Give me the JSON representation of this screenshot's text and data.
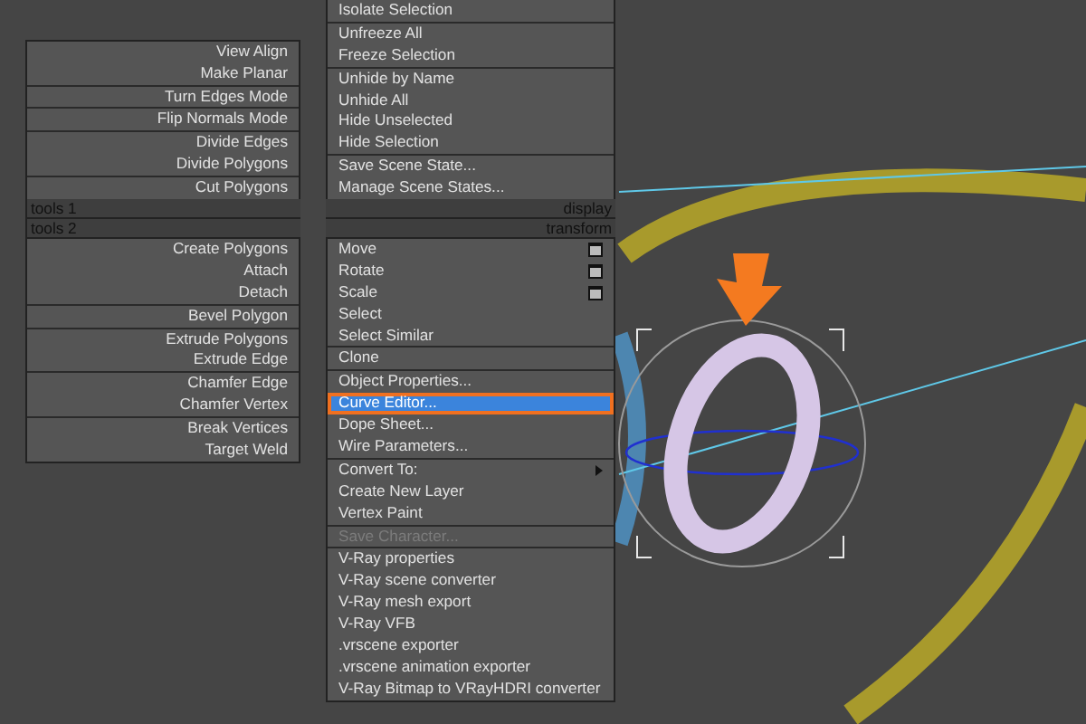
{
  "left_top_groups": [
    [
      {
        "label": "View Align",
        "selected": false,
        "disabled": false
      },
      {
        "label": "Make Planar",
        "selected": false,
        "disabled": false
      }
    ],
    [
      {
        "label": "Turn Edges Mode",
        "selected": false,
        "disabled": false
      }
    ],
    [
      {
        "label": "Flip Normals Mode",
        "selected": false,
        "disabled": false
      }
    ],
    [
      {
        "label": "Divide Edges",
        "selected": false,
        "disabled": false
      },
      {
        "label": "Divide Polygons",
        "selected": false,
        "disabled": false
      }
    ],
    [
      {
        "label": "Cut Polygons",
        "selected": false,
        "disabled": false
      }
    ]
  ],
  "right_top_groups": [
    [
      {
        "label": "Isolate Selection",
        "selected": false,
        "disabled": false
      }
    ],
    [
      {
        "label": "Unfreeze All",
        "selected": false,
        "disabled": false
      },
      {
        "label": "Freeze Selection",
        "selected": false,
        "disabled": false
      }
    ],
    [
      {
        "label": "Unhide by Name",
        "selected": false,
        "disabled": false
      },
      {
        "label": "Unhide All",
        "selected": false,
        "disabled": false
      },
      {
        "label": "Hide Unselected",
        "selected": false,
        "disabled": false
      },
      {
        "label": "Hide Selection",
        "selected": false,
        "disabled": false
      }
    ],
    [
      {
        "label": "Save Scene State...",
        "selected": false,
        "disabled": false
      },
      {
        "label": "Manage Scene States...",
        "selected": false,
        "disabled": false
      }
    ]
  ],
  "headers": [
    {
      "left": "tools 1",
      "right": "display"
    },
    {
      "left": "tools 2",
      "right": "transform"
    }
  ],
  "left_bottom_groups": [
    [
      {
        "label": "Create Polygons",
        "selected": false,
        "disabled": false
      },
      {
        "label": "Attach",
        "selected": false,
        "disabled": false
      },
      {
        "label": "Detach",
        "selected": false,
        "disabled": false
      }
    ],
    [
      {
        "label": "Bevel Polygon",
        "selected": false,
        "disabled": false
      }
    ],
    [
      {
        "label": "Extrude Polygons",
        "selected": false,
        "disabled": false
      },
      {
        "label": "Extrude Edge",
        "selected": false,
        "disabled": false
      }
    ],
    [
      {
        "label": "Chamfer Edge",
        "selected": false,
        "disabled": false
      },
      {
        "label": "Chamfer Vertex",
        "selected": false,
        "disabled": false
      }
    ],
    [
      {
        "label": "Break Vertices",
        "selected": false,
        "disabled": false
      },
      {
        "label": "Target Weld",
        "selected": false,
        "disabled": false
      }
    ]
  ],
  "right_bottom_groups": [
    [
      {
        "label": "Move",
        "selected": false,
        "disabled": false,
        "has_options": true
      },
      {
        "label": "Rotate",
        "selected": false,
        "disabled": false,
        "has_options": true
      },
      {
        "label": "Scale",
        "selected": false,
        "disabled": false,
        "has_options": true
      },
      {
        "label": "Select",
        "selected": false,
        "disabled": false
      },
      {
        "label": "Select Similar",
        "selected": false,
        "disabled": false
      }
    ],
    [
      {
        "label": "Clone",
        "selected": false,
        "disabled": false
      }
    ],
    [
      {
        "label": "Object Properties...",
        "selected": false,
        "disabled": false
      },
      {
        "label": "Curve Editor...",
        "selected": true,
        "disabled": false
      },
      {
        "label": "Dope Sheet...",
        "selected": false,
        "disabled": false
      },
      {
        "label": "Wire Parameters...",
        "selected": false,
        "disabled": false
      }
    ],
    [
      {
        "label": "Convert To:",
        "selected": false,
        "disabled": false,
        "submenu": true
      },
      {
        "label": "Create New Layer",
        "selected": false,
        "disabled": false
      },
      {
        "label": "Vertex Paint",
        "selected": false,
        "disabled": false
      }
    ],
    [
      {
        "label": "Save Character...",
        "selected": false,
        "disabled": true
      }
    ],
    [
      {
        "label": "V-Ray properties",
        "selected": false,
        "disabled": false
      },
      {
        "label": "V-Ray scene converter",
        "selected": false,
        "disabled": false
      },
      {
        "label": "V-Ray mesh export",
        "selected": false,
        "disabled": false
      },
      {
        "label": "V-Ray VFB",
        "selected": false,
        "disabled": false
      },
      {
        "label": ".vrscene exporter",
        "selected": false,
        "disabled": false
      },
      {
        "label": ".vrscene animation exporter",
        "selected": false,
        "disabled": false
      },
      {
        "label": "V-Ray Bitmap to VRayHDRI converter",
        "selected": false,
        "disabled": false
      }
    ]
  ]
}
